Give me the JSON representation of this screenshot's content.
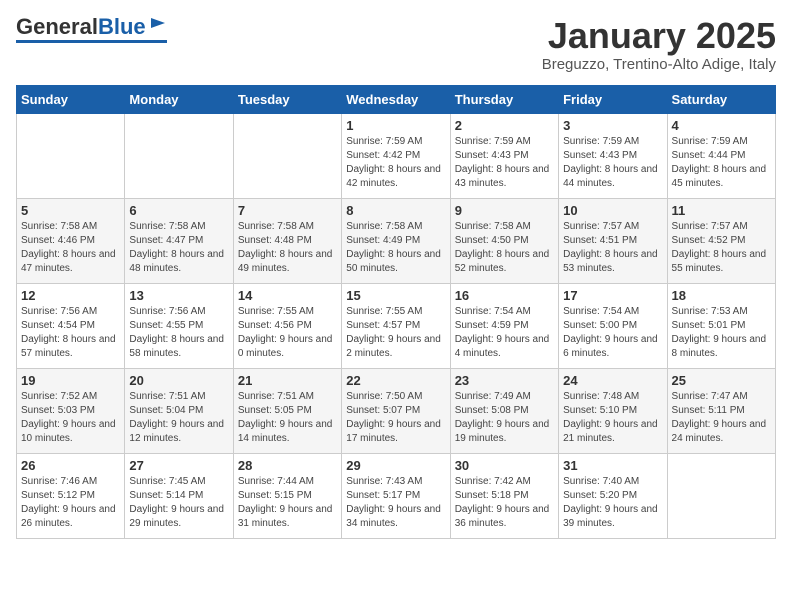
{
  "logo": {
    "text_general": "General",
    "text_blue": "Blue"
  },
  "title": "January 2025",
  "location": "Breguzzo, Trentino-Alto Adige, Italy",
  "headers": [
    "Sunday",
    "Monday",
    "Tuesday",
    "Wednesday",
    "Thursday",
    "Friday",
    "Saturday"
  ],
  "weeks": [
    [
      {
        "day": "",
        "info": ""
      },
      {
        "day": "",
        "info": ""
      },
      {
        "day": "",
        "info": ""
      },
      {
        "day": "1",
        "info": "Sunrise: 7:59 AM\nSunset: 4:42 PM\nDaylight: 8 hours and 42 minutes."
      },
      {
        "day": "2",
        "info": "Sunrise: 7:59 AM\nSunset: 4:43 PM\nDaylight: 8 hours and 43 minutes."
      },
      {
        "day": "3",
        "info": "Sunrise: 7:59 AM\nSunset: 4:43 PM\nDaylight: 8 hours and 44 minutes."
      },
      {
        "day": "4",
        "info": "Sunrise: 7:59 AM\nSunset: 4:44 PM\nDaylight: 8 hours and 45 minutes."
      }
    ],
    [
      {
        "day": "5",
        "info": "Sunrise: 7:58 AM\nSunset: 4:46 PM\nDaylight: 8 hours and 47 minutes."
      },
      {
        "day": "6",
        "info": "Sunrise: 7:58 AM\nSunset: 4:47 PM\nDaylight: 8 hours and 48 minutes."
      },
      {
        "day": "7",
        "info": "Sunrise: 7:58 AM\nSunset: 4:48 PM\nDaylight: 8 hours and 49 minutes."
      },
      {
        "day": "8",
        "info": "Sunrise: 7:58 AM\nSunset: 4:49 PM\nDaylight: 8 hours and 50 minutes."
      },
      {
        "day": "9",
        "info": "Sunrise: 7:58 AM\nSunset: 4:50 PM\nDaylight: 8 hours and 52 minutes."
      },
      {
        "day": "10",
        "info": "Sunrise: 7:57 AM\nSunset: 4:51 PM\nDaylight: 8 hours and 53 minutes."
      },
      {
        "day": "11",
        "info": "Sunrise: 7:57 AM\nSunset: 4:52 PM\nDaylight: 8 hours and 55 minutes."
      }
    ],
    [
      {
        "day": "12",
        "info": "Sunrise: 7:56 AM\nSunset: 4:54 PM\nDaylight: 8 hours and 57 minutes."
      },
      {
        "day": "13",
        "info": "Sunrise: 7:56 AM\nSunset: 4:55 PM\nDaylight: 8 hours and 58 minutes."
      },
      {
        "day": "14",
        "info": "Sunrise: 7:55 AM\nSunset: 4:56 PM\nDaylight: 9 hours and 0 minutes."
      },
      {
        "day": "15",
        "info": "Sunrise: 7:55 AM\nSunset: 4:57 PM\nDaylight: 9 hours and 2 minutes."
      },
      {
        "day": "16",
        "info": "Sunrise: 7:54 AM\nSunset: 4:59 PM\nDaylight: 9 hours and 4 minutes."
      },
      {
        "day": "17",
        "info": "Sunrise: 7:54 AM\nSunset: 5:00 PM\nDaylight: 9 hours and 6 minutes."
      },
      {
        "day": "18",
        "info": "Sunrise: 7:53 AM\nSunset: 5:01 PM\nDaylight: 9 hours and 8 minutes."
      }
    ],
    [
      {
        "day": "19",
        "info": "Sunrise: 7:52 AM\nSunset: 5:03 PM\nDaylight: 9 hours and 10 minutes."
      },
      {
        "day": "20",
        "info": "Sunrise: 7:51 AM\nSunset: 5:04 PM\nDaylight: 9 hours and 12 minutes."
      },
      {
        "day": "21",
        "info": "Sunrise: 7:51 AM\nSunset: 5:05 PM\nDaylight: 9 hours and 14 minutes."
      },
      {
        "day": "22",
        "info": "Sunrise: 7:50 AM\nSunset: 5:07 PM\nDaylight: 9 hours and 17 minutes."
      },
      {
        "day": "23",
        "info": "Sunrise: 7:49 AM\nSunset: 5:08 PM\nDaylight: 9 hours and 19 minutes."
      },
      {
        "day": "24",
        "info": "Sunrise: 7:48 AM\nSunset: 5:10 PM\nDaylight: 9 hours and 21 minutes."
      },
      {
        "day": "25",
        "info": "Sunrise: 7:47 AM\nSunset: 5:11 PM\nDaylight: 9 hours and 24 minutes."
      }
    ],
    [
      {
        "day": "26",
        "info": "Sunrise: 7:46 AM\nSunset: 5:12 PM\nDaylight: 9 hours and 26 minutes."
      },
      {
        "day": "27",
        "info": "Sunrise: 7:45 AM\nSunset: 5:14 PM\nDaylight: 9 hours and 29 minutes."
      },
      {
        "day": "28",
        "info": "Sunrise: 7:44 AM\nSunset: 5:15 PM\nDaylight: 9 hours and 31 minutes."
      },
      {
        "day": "29",
        "info": "Sunrise: 7:43 AM\nSunset: 5:17 PM\nDaylight: 9 hours and 34 minutes."
      },
      {
        "day": "30",
        "info": "Sunrise: 7:42 AM\nSunset: 5:18 PM\nDaylight: 9 hours and 36 minutes."
      },
      {
        "day": "31",
        "info": "Sunrise: 7:40 AM\nSunset: 5:20 PM\nDaylight: 9 hours and 39 minutes."
      },
      {
        "day": "",
        "info": ""
      }
    ]
  ]
}
